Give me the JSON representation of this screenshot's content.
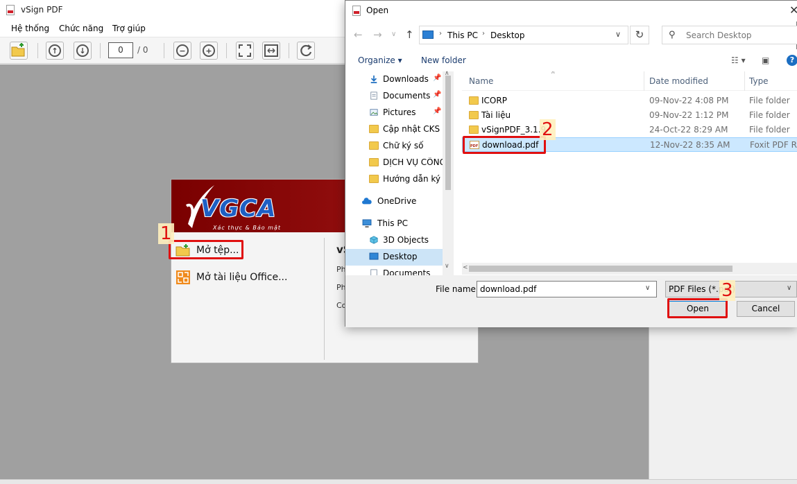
{
  "main_window": {
    "title": "vSign PDF",
    "menu": [
      "Hệ thống",
      "Chức năng",
      "Trợ giúp"
    ],
    "page_current": "0",
    "page_total": "/ 0",
    "start_panel": {
      "logo_text": "VGCA",
      "logo_tagline": "Xác thực & Bảo mật",
      "open_file_label": "Mở tệp...",
      "open_office_label": "Mở tài liệu Office...",
      "right_heading": "vS",
      "right_lines": [
        "Ph",
        "Ph",
        "Co"
      ]
    }
  },
  "dialog": {
    "title": "Open",
    "breadcrumb": [
      "This PC",
      "Desktop"
    ],
    "search_placeholder": "Search Desktop",
    "commands": {
      "organize": "Organize ▾",
      "new_folder": "New folder"
    },
    "nav_items": [
      {
        "label": "Downloads",
        "icon": "download-arrow-icon",
        "pinned": true
      },
      {
        "label": "Documents",
        "icon": "documents-icon",
        "pinned": true
      },
      {
        "label": "Pictures",
        "icon": "pictures-icon",
        "pinned": true
      },
      {
        "label": "Cập nhật CKS lên",
        "icon": "folder-icon",
        "pinned": false
      },
      {
        "label": "Chữ ký số",
        "icon": "folder-icon",
        "pinned": false
      },
      {
        "label": "DỊCH VỤ CÔNG",
        "icon": "folder-icon",
        "pinned": false
      },
      {
        "label": "Hướng dẫn ký ch",
        "icon": "folder-icon",
        "pinned": false
      },
      {
        "label": "OneDrive",
        "icon": "cloud-icon",
        "pinned": false
      },
      {
        "label": "This PC",
        "icon": "computer-icon",
        "pinned": false
      },
      {
        "label": "3D Objects",
        "icon": "cube-icon",
        "pinned": false
      },
      {
        "label": "Desktop",
        "icon": "desktop-icon",
        "pinned": false,
        "selected": true
      },
      {
        "label": "Documents",
        "icon": "documents-icon",
        "pinned": false
      }
    ],
    "columns": {
      "name": "Name",
      "date": "Date modified",
      "type": "Type"
    },
    "files": [
      {
        "name": "ICORP",
        "date": "09-Nov-22 4:08 PM",
        "type": "File folder",
        "icon": "folder-icon"
      },
      {
        "name": "Tài liệu",
        "date": "09-Nov-22 1:12 PM",
        "type": "File folder",
        "icon": "folder-icon"
      },
      {
        "name": "vSignPDF_3.1.9",
        "date": "24-Oct-22 8:29 AM",
        "type": "File folder",
        "icon": "folder-icon"
      },
      {
        "name": "download.pdf",
        "date": "12-Nov-22 8:35 AM",
        "type": "Foxit PDF Rea",
        "icon": "pdf-file-icon",
        "selected": true
      }
    ],
    "file_name_label": "File name:",
    "file_name_value": "download.pdf",
    "file_type_value": "PDF Files (*.pdf)",
    "open_label": "Open",
    "cancel_label": "Cancel"
  },
  "annotations": [
    "1",
    "2",
    "3"
  ],
  "colors": {
    "annotation": "#e01010",
    "selection": "#cce8ff",
    "banner": "#8b0a0a",
    "logo_blue": "#1e5fc4"
  }
}
